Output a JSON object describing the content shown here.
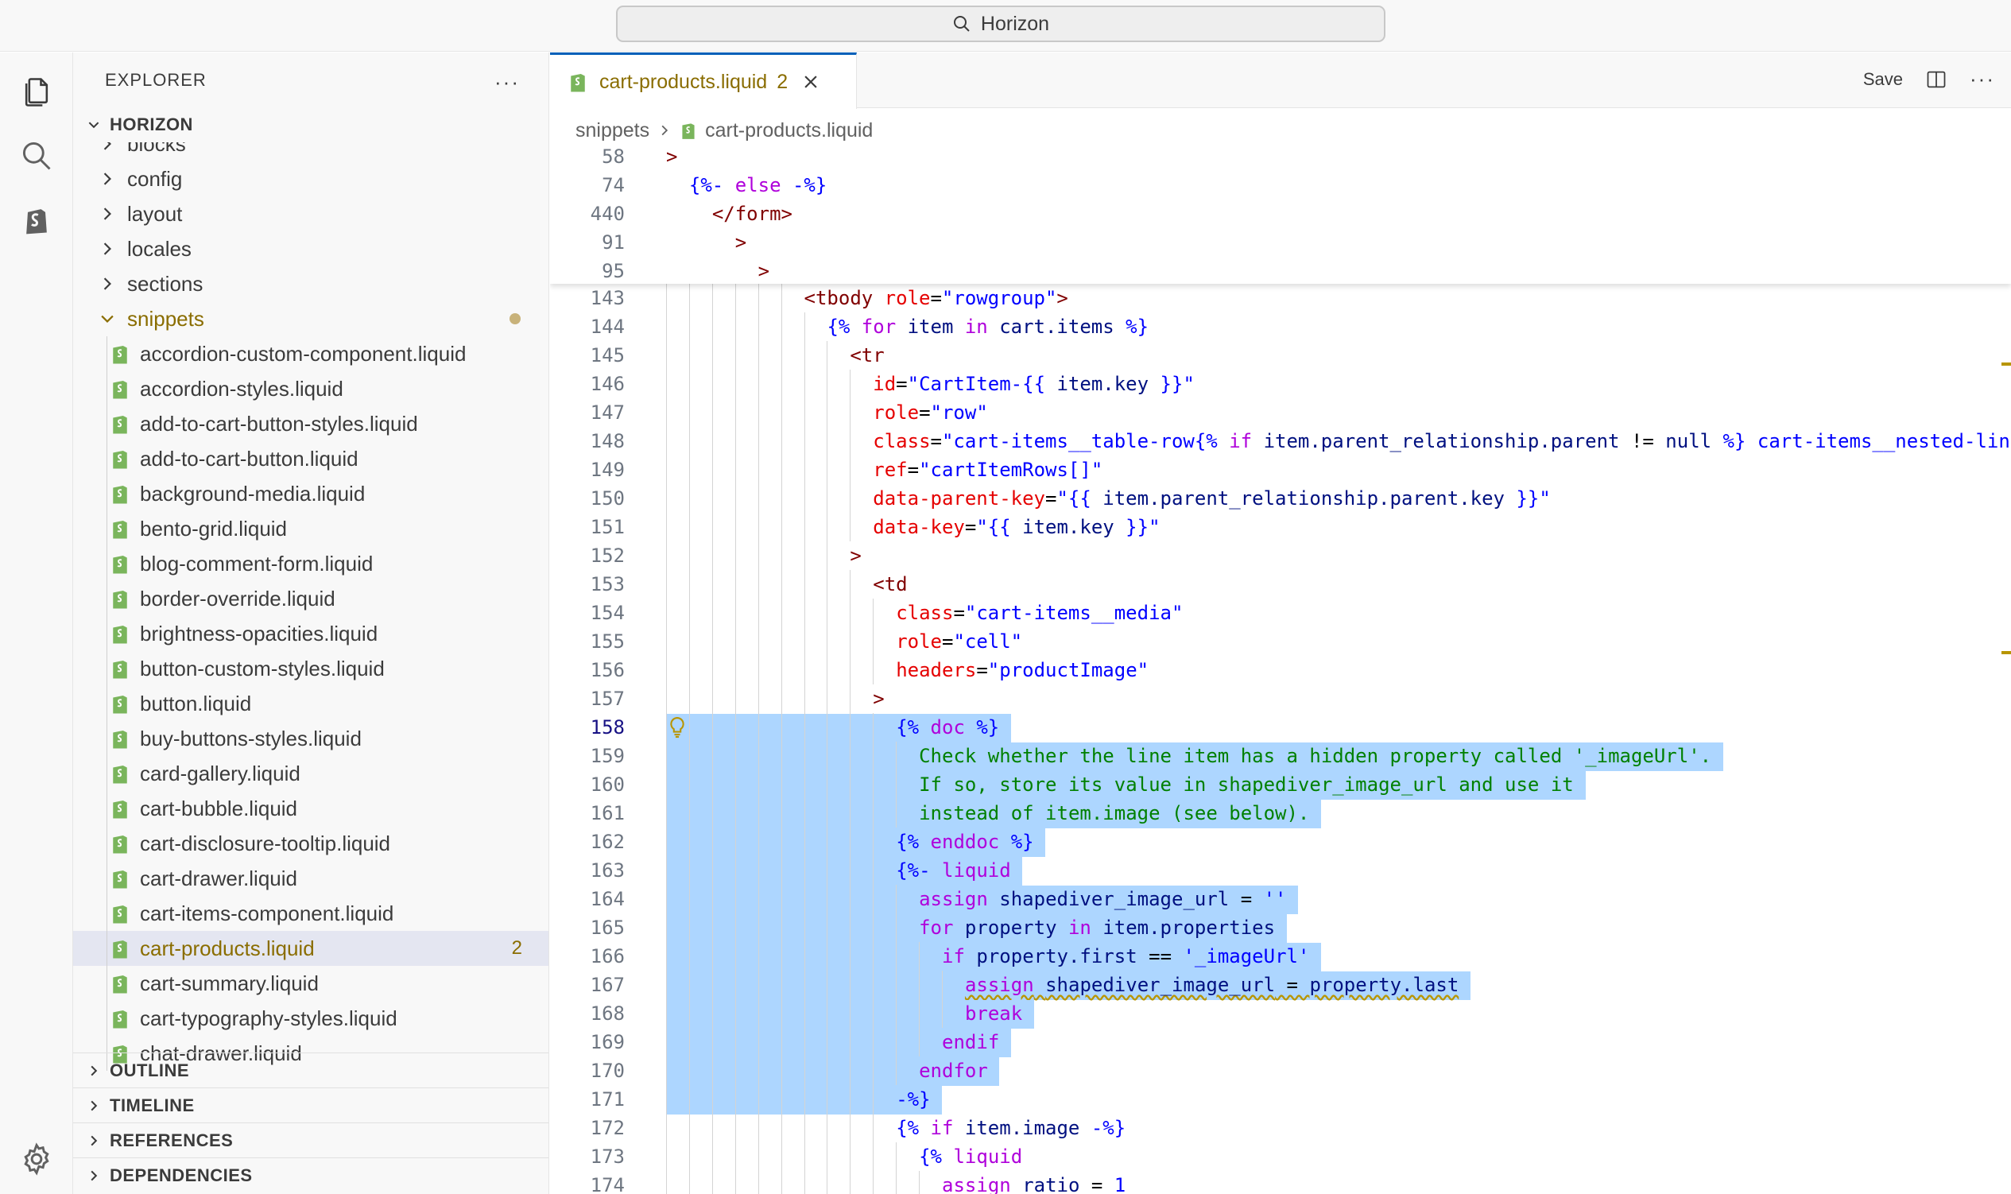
{
  "window": {
    "search_text": "Horizon"
  },
  "activity_bar": {
    "icons": [
      "explorer-icon",
      "search-icon",
      "shopify-icon",
      "settings-gear-icon"
    ]
  },
  "sidebar": {
    "title": "EXPLORER",
    "more": "···",
    "root": "HORIZON",
    "folders": [
      {
        "label": "blocks"
      },
      {
        "label": "config"
      },
      {
        "label": "layout"
      },
      {
        "label": "locales"
      },
      {
        "label": "sections"
      },
      {
        "label": "snippets"
      }
    ],
    "files": [
      "accordion-custom-component.liquid",
      "accordion-styles.liquid",
      "add-to-cart-button-styles.liquid",
      "add-to-cart-button.liquid",
      "background-media.liquid",
      "bento-grid.liquid",
      "blog-comment-form.liquid",
      "border-override.liquid",
      "brightness-opacities.liquid",
      "button-custom-styles.liquid",
      "button.liquid",
      "buy-buttons-styles.liquid",
      "card-gallery.liquid",
      "cart-bubble.liquid",
      "cart-disclosure-tooltip.liquid",
      "cart-drawer.liquid",
      "cart-items-component.liquid",
      "cart-products.liquid",
      "cart-summary.liquid",
      "cart-typography-styles.liquid",
      "chat-drawer.liquid"
    ],
    "selected_badge": "2",
    "bottom_sections": [
      "OUTLINE",
      "TIMELINE",
      "REFERENCES",
      "DEPENDENCIES"
    ]
  },
  "editor": {
    "tab": {
      "label": "cart-products.liquid",
      "badge": "2"
    },
    "actions": {
      "save": "Save",
      "more": "···"
    },
    "breadcrumb": {
      "folder": "snippets",
      "file": "cart-products.liquid"
    },
    "sticky_lines": [
      {
        "n": "58",
        "tokens": [
          [
            "t-tag",
            ">"
          ]
        ]
      },
      {
        "n": "74",
        "tokens": [
          [
            "t-delim",
            "{%-"
          ],
          [
            "t-kw",
            " else "
          ],
          [
            "t-delim",
            "-%}"
          ]
        ]
      },
      {
        "n": "440",
        "tokens": [
          [
            "t-tag",
            "</form>"
          ]
        ]
      },
      {
        "n": "91",
        "tokens": [
          [
            "t-tag",
            ">"
          ]
        ]
      },
      {
        "n": "95",
        "tokens": [
          [
            "t-tag",
            ">"
          ]
        ]
      }
    ],
    "lines": [
      {
        "n": "143",
        "tokens": [
          [
            "t-tag",
            "<tbody"
          ],
          [
            "",
            " "
          ],
          [
            "t-attr",
            "role"
          ],
          [
            "t-op",
            "="
          ],
          [
            "t-str",
            "\"rowgroup\""
          ],
          [
            "t-tag",
            ">"
          ]
        ]
      },
      {
        "n": "144",
        "tokens": [
          [
            "t-delim",
            "{%"
          ],
          [
            "t-kw",
            " for "
          ],
          [
            "t-var",
            "item"
          ],
          [
            "t-kw",
            " in "
          ],
          [
            "t-var",
            "cart.items"
          ],
          [
            "t-delim",
            " %}"
          ]
        ]
      },
      {
        "n": "145",
        "tokens": [
          [
            "t-tag",
            "<tr"
          ]
        ]
      },
      {
        "n": "146",
        "tokens": [
          [
            "t-attr",
            "id"
          ],
          [
            "t-op",
            "="
          ],
          [
            "t-str",
            "\"CartItem-"
          ],
          [
            "t-delim",
            "{{"
          ],
          [
            "t-var",
            " item.key "
          ],
          [
            "t-delim",
            "}}"
          ],
          [
            "t-str",
            "\""
          ]
        ]
      },
      {
        "n": "147",
        "tokens": [
          [
            "t-attr",
            "role"
          ],
          [
            "t-op",
            "="
          ],
          [
            "t-str",
            "\"row\""
          ]
        ]
      },
      {
        "n": "148",
        "tokens": [
          [
            "t-attr",
            "class"
          ],
          [
            "t-op",
            "="
          ],
          [
            "t-str",
            "\"cart-items__table-row"
          ],
          [
            "t-delim",
            "{%"
          ],
          [
            "t-kw",
            " if "
          ],
          [
            "t-var",
            "item.parent_relationship.parent"
          ],
          [
            "t-op",
            " != "
          ],
          [
            "t-var",
            "null"
          ],
          [
            "t-delim",
            " %}"
          ],
          [
            "t-str",
            " cart-items__nested-line"
          ],
          [
            "t-delim",
            "{"
          ]
        ]
      },
      {
        "n": "149",
        "tokens": [
          [
            "t-attr",
            "ref"
          ],
          [
            "t-op",
            "="
          ],
          [
            "t-str",
            "\"cartItemRows[]\""
          ]
        ]
      },
      {
        "n": "150",
        "tokens": [
          [
            "t-attr",
            "data-parent-key"
          ],
          [
            "t-op",
            "="
          ],
          [
            "t-str",
            "\""
          ],
          [
            "t-delim",
            "{{"
          ],
          [
            "t-var",
            " item.parent_relationship.parent.key "
          ],
          [
            "t-delim",
            "}}"
          ],
          [
            "t-str",
            "\""
          ]
        ]
      },
      {
        "n": "151",
        "tokens": [
          [
            "t-attr",
            "data-key"
          ],
          [
            "t-op",
            "="
          ],
          [
            "t-str",
            "\""
          ],
          [
            "t-delim",
            "{{"
          ],
          [
            "t-var",
            " item.key "
          ],
          [
            "t-delim",
            "}}"
          ],
          [
            "t-str",
            "\""
          ]
        ]
      },
      {
        "n": "152",
        "tokens": [
          [
            "t-tag",
            ">"
          ]
        ]
      },
      {
        "n": "153",
        "tokens": [
          [
            "t-tag",
            "<td"
          ]
        ]
      },
      {
        "n": "154",
        "tokens": [
          [
            "t-attr",
            "class"
          ],
          [
            "t-op",
            "="
          ],
          [
            "t-str",
            "\"cart-items__media\""
          ]
        ]
      },
      {
        "n": "155",
        "tokens": [
          [
            "t-attr",
            "role"
          ],
          [
            "t-op",
            "="
          ],
          [
            "t-str",
            "\"cell\""
          ]
        ]
      },
      {
        "n": "156",
        "tokens": [
          [
            "t-attr",
            "headers"
          ],
          [
            "t-op",
            "="
          ],
          [
            "t-str",
            "\"productImage\""
          ]
        ]
      },
      {
        "n": "157",
        "tokens": [
          [
            "t-tag",
            ">"
          ]
        ]
      },
      {
        "n": "158",
        "tokens": [
          [
            "t-delim",
            "{%"
          ],
          [
            "t-kw",
            " doc "
          ],
          [
            "t-delim",
            "%}"
          ]
        ]
      },
      {
        "n": "159",
        "tokens": [
          [
            "t-cmt",
            "Check whether the line item has a hidden property called '_imageUrl'."
          ]
        ]
      },
      {
        "n": "160",
        "tokens": [
          [
            "t-cmt",
            "If so, store its value in shapediver_image_url and use it"
          ]
        ]
      },
      {
        "n": "161",
        "tokens": [
          [
            "t-cmt",
            "instead of item.image (see below)."
          ]
        ]
      },
      {
        "n": "162",
        "tokens": [
          [
            "t-delim",
            "{%"
          ],
          [
            "t-kw",
            " enddoc "
          ],
          [
            "t-delim",
            "%}"
          ]
        ]
      },
      {
        "n": "163",
        "tokens": [
          [
            "t-delim",
            "{%-"
          ],
          [
            "t-kw",
            " liquid"
          ]
        ]
      },
      {
        "n": "164",
        "tokens": [
          [
            "t-kw",
            "assign"
          ],
          [
            "",
            " "
          ],
          [
            "t-var",
            "shapediver_image_url"
          ],
          [
            "t-op",
            " = "
          ],
          [
            "t-str",
            "''"
          ]
        ]
      },
      {
        "n": "165",
        "tokens": [
          [
            "t-kw",
            "for"
          ],
          [
            "",
            " "
          ],
          [
            "t-var",
            "property"
          ],
          [
            "t-kw",
            " in "
          ],
          [
            "t-var",
            "item.properties"
          ]
        ]
      },
      {
        "n": "166",
        "tokens": [
          [
            "t-kw",
            "if"
          ],
          [
            "",
            " "
          ],
          [
            "t-var",
            "property.first"
          ],
          [
            "t-op",
            " == "
          ],
          [
            "t-str",
            "'_imageUrl'"
          ]
        ]
      },
      {
        "n": "167",
        "tokens": [
          [
            "t-kw squiggle",
            "assign"
          ],
          [
            "squiggle",
            " "
          ],
          [
            "t-var squiggle",
            "shapediver_image_url"
          ],
          [
            "t-op squiggle",
            " = "
          ],
          [
            "t-var squiggle",
            "property.last"
          ]
        ]
      },
      {
        "n": "168",
        "tokens": [
          [
            "t-kw",
            "break"
          ]
        ]
      },
      {
        "n": "169",
        "tokens": [
          [
            "t-kw",
            "endif"
          ]
        ]
      },
      {
        "n": "170",
        "tokens": [
          [
            "t-kw",
            "endfor"
          ]
        ]
      },
      {
        "n": "171",
        "tokens": [
          [
            "t-delim",
            "-%}"
          ]
        ]
      },
      {
        "n": "172",
        "tokens": [
          [
            "t-delim",
            "{%"
          ],
          [
            "t-kw",
            " if "
          ],
          [
            "t-var",
            "item.image"
          ],
          [
            "t-delim",
            " -%}"
          ]
        ]
      },
      {
        "n": "173",
        "tokens": [
          [
            "t-delim",
            "{%"
          ],
          [
            "t-kw",
            " liquid"
          ]
        ]
      },
      {
        "n": "174",
        "tokens": [
          [
            "t-kw",
            "assign"
          ],
          [
            "",
            " "
          ],
          [
            "t-var",
            "ratio"
          ],
          [
            "t-op",
            " = "
          ],
          [
            "t-str",
            "1"
          ]
        ]
      }
    ]
  }
}
